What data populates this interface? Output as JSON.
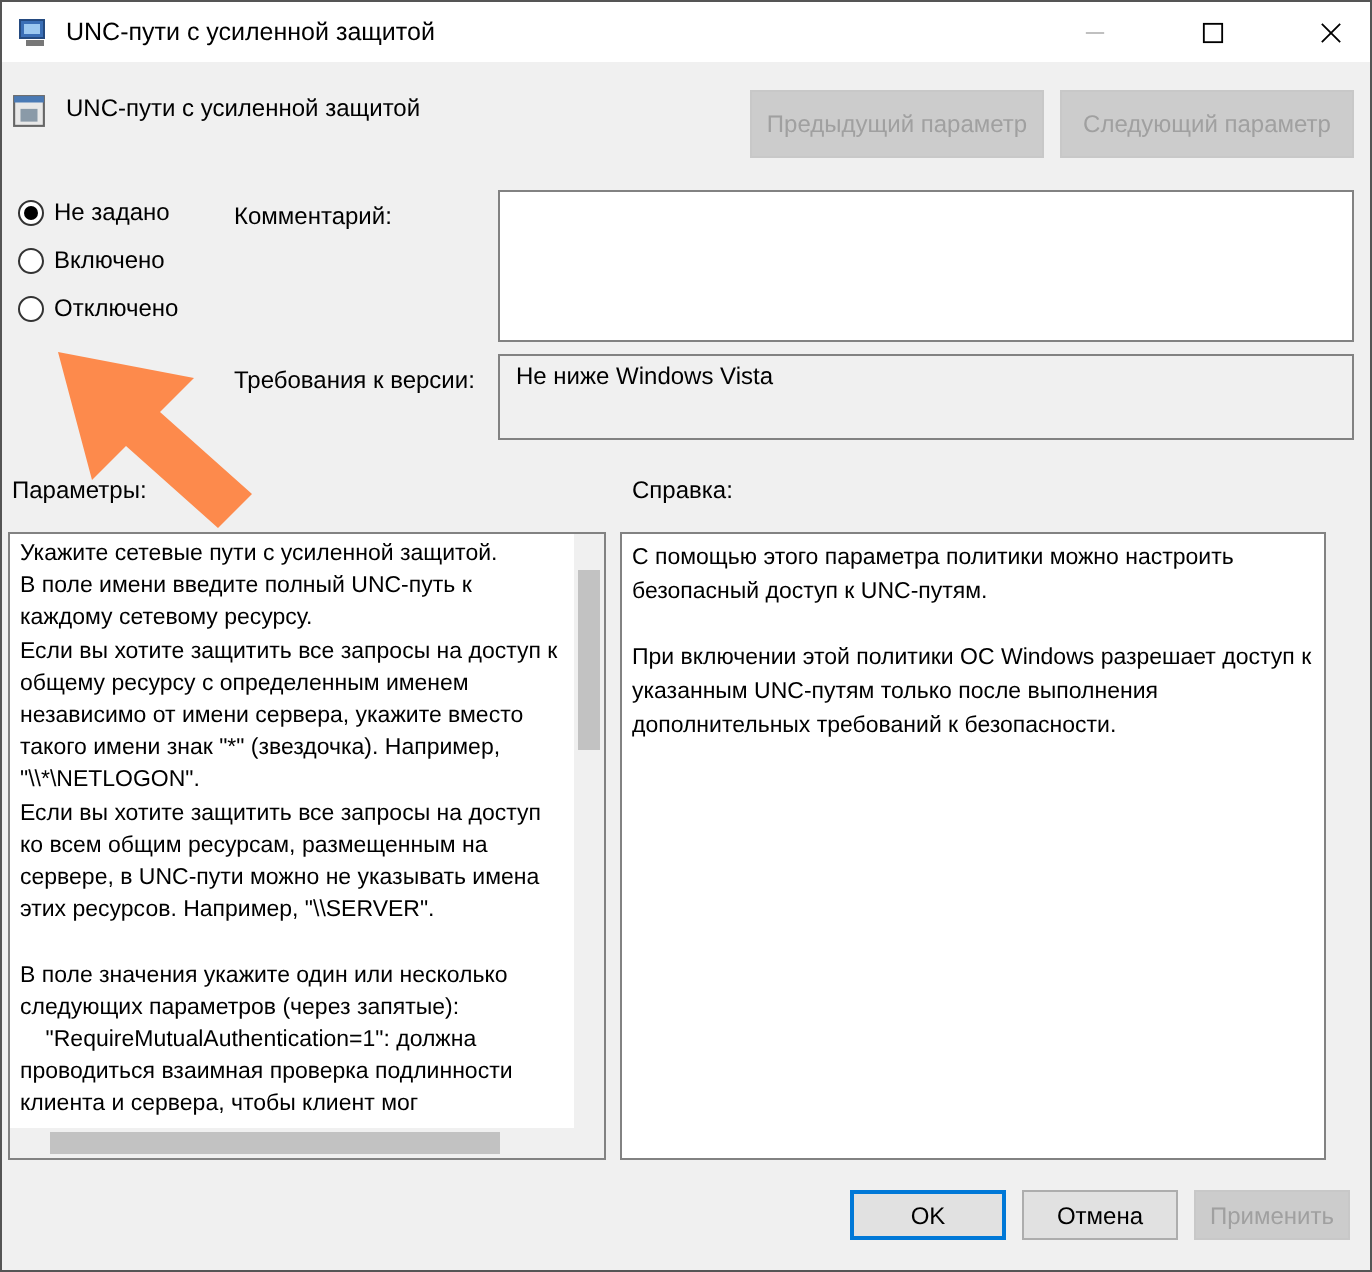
{
  "window": {
    "title": "UNC-пути с усиленной защитой"
  },
  "header": {
    "policy_name": "UNC-пути с усиленной защитой",
    "buttons": [
      {
        "label": "Предыдущий параметр",
        "disabled": true
      },
      {
        "label": "Следующий параметр",
        "disabled": true
      }
    ]
  },
  "state_options": [
    {
      "label": "Не задано",
      "selected": true
    },
    {
      "label": "Включено",
      "selected": false
    },
    {
      "label": "Отключено",
      "selected": false
    }
  ],
  "comment": {
    "label": "Комментарий:"
  },
  "requirements": {
    "label": "Требования к версии:",
    "value": "Не ниже Windows Vista"
  },
  "options_panel": {
    "label": "Параметры:",
    "paragraphs": [
      "Укажите сетевые пути с усиленной защитой.\nВ поле имени введите полный UNC-путь к\nкаждому сетевому ресурсу.\nЕсли вы хотите защитить все запросы на доступ к\nобщему ресурсу с определенным именем\nнезависимо от имени сервера, укажите вместо\nтакого имени знак \"*\" (звездочка). Например,\n\"\\\\*\\NETLOGON\".\nЕсли вы хотите защитить все запросы на доступ\nко всем общим ресурсам, размещенным на\nсервере, в UNC-пути можно не указывать имена\nэтих ресурсов. Например, \"\\\\SERVER\".",
      "В поле значения укажите один или несколько\nследующих параметров (через запятые):\n    \"RequireMutualAuthentication=1\": должна\nпроводиться взаимная проверка подлинности\nклиента и сервера, чтобы клиент мог"
    ]
  },
  "help_panel": {
    "label": "Справка:",
    "paragraphs": [
      "С помощью этого параметра политики можно настроить безопасный доступ к UNC-путям.",
      "При включении этой политики ОС Windows разрешает доступ к указанным UNC-путям только после выполнения дополнительных требований к безопасности."
    ]
  },
  "footer_buttons": [
    {
      "label": "OK",
      "disabled": false,
      "default": true
    },
    {
      "label": "Отмена",
      "disabled": false,
      "default": false
    },
    {
      "label": "Применить",
      "disabled": true,
      "default": false
    }
  ]
}
